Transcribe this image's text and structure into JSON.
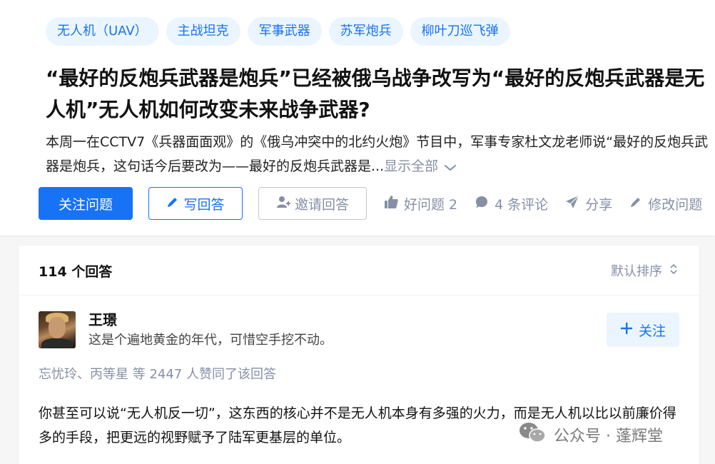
{
  "topics": [
    "无人机（UAV）",
    "主战坦克",
    "军事武器",
    "苏军炮兵",
    "柳叶刀巡飞弹"
  ],
  "question": {
    "title": "“最好的反炮兵武器是炮兵”已经被俄乌战争改写为“最好的反炮兵武器是无人机”无人机如何改变未来战争武器?",
    "excerpt": "本周一在CCTV7《兵器面面观》的《俄乌冲突中的北约火炮》节目中，军事专家杜文龙老师说“最好的反炮兵武器是炮兵，这句话今后要改为——最好的反炮兵武器是...",
    "show_all": "显示全部"
  },
  "actions": {
    "follow_question": "关注问题",
    "write_answer": "写回答",
    "invite_answer": "邀请回答",
    "good_question": "好问题 2",
    "comments": "4 条评论",
    "share": "分享",
    "edit_question": "修改问题"
  },
  "answers": {
    "count_label": "114 个回答",
    "sort_label": "默认排序"
  },
  "answer": {
    "author_name": "王璟",
    "author_bio": "这是个遍地黄金的年代，可惜空手挖不动。",
    "follow_label": "关注",
    "voters": "忘忧玲、丙等星 等 2447 人赞同了该回答",
    "content": "你甚至可以说“无人机反一切”，这东西的核心并不是无人机本身有多强的火力，而是无人机以比以前廉价得多的手段，把更远的视野赋予了陆军更基层的单位。"
  },
  "watermark": {
    "text": "公众号 · 蓬辉堂",
    "icon": "wechat-icon"
  },
  "colors": {
    "accent": "#1772f6",
    "tag_bg": "#ebf5ff",
    "muted": "#8590a6",
    "page_bg": "#f6f6f6"
  }
}
